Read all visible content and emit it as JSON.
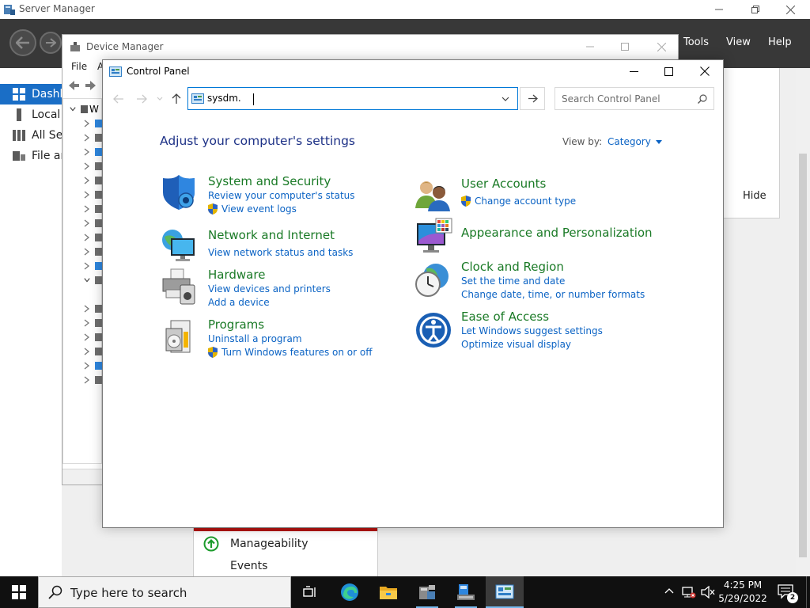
{
  "server_manager": {
    "title": "Server Manager",
    "menu": [
      "Tools",
      "View",
      "Help"
    ],
    "sidebar": [
      {
        "label": "Dashboard",
        "icon": "dashboard-grid-icon",
        "active": true
      },
      {
        "label": "Local Server",
        "icon": "server-icon",
        "active": false
      },
      {
        "label": "All Servers",
        "icon": "servers-icon",
        "active": false
      },
      {
        "label": "File and Storage Services",
        "icon": "storage-icon",
        "active": false
      }
    ],
    "hide_label": "Hide",
    "card": {
      "items": [
        {
          "label": "Manageability",
          "icon": "status-up-icon"
        },
        {
          "label": "Events",
          "icon": ""
        }
      ]
    }
  },
  "device_manager": {
    "title": "Device Manager",
    "menu": [
      "File",
      "A"
    ],
    "tree_root_label": "W"
  },
  "control_panel": {
    "title": "Control Panel",
    "address": "sysdm.",
    "search_placeholder": "Search Control Panel",
    "heading": "Adjust your computer's settings",
    "view_by_label": "View by:",
    "view_by_value": "Category",
    "categories": [
      {
        "title": "System and Security",
        "icon": "system-security-icon",
        "links": [
          {
            "label": "Review your computer's status",
            "shield": false
          },
          {
            "label": "View event logs",
            "shield": true
          }
        ]
      },
      {
        "title": "Network and Internet",
        "icon": "network-globe-icon",
        "links": [
          {
            "label": "View network status and tasks",
            "shield": false
          }
        ]
      },
      {
        "title": "Hardware",
        "icon": "printer-icon",
        "links": [
          {
            "label": "View devices and printers",
            "shield": false
          },
          {
            "label": "Add a device",
            "shield": false
          }
        ]
      },
      {
        "title": "Programs",
        "icon": "programs-disk-icon",
        "links": [
          {
            "label": "Uninstall a program",
            "shield": false
          },
          {
            "label": "Turn Windows features on or off",
            "shield": true
          }
        ]
      },
      {
        "title": "User Accounts",
        "icon": "user-accounts-icon",
        "links": [
          {
            "label": "Change account type",
            "shield": true
          }
        ]
      },
      {
        "title": "Appearance and Personalization",
        "icon": "appearance-monitor-icon",
        "links": []
      },
      {
        "title": "Clock and Region",
        "icon": "clock-globe-icon",
        "links": [
          {
            "label": "Set the time and date",
            "shield": false
          },
          {
            "label": "Change date, time, or number formats",
            "shield": false
          }
        ]
      },
      {
        "title": "Ease of Access",
        "icon": "ease-of-access-icon",
        "links": [
          {
            "label": "Let Windows suggest settings",
            "shield": false
          },
          {
            "label": "Optimize visual display",
            "shield": false
          }
        ]
      }
    ]
  },
  "taskbar": {
    "search_placeholder": "Type here to search",
    "apps": [
      "task-view-icon",
      "edge-icon",
      "file-explorer-icon",
      "server-manager-icon",
      "device-manager-icon",
      "control-panel-icon"
    ],
    "time": "4:25 PM",
    "date": "5/29/2022",
    "notification_count": "2"
  },
  "colors": {
    "heading": "#1e3287",
    "category_title": "#1a7a26",
    "link": "#0b63c4",
    "sm_nav": "#383838",
    "sm_active": "#1a6ec6"
  }
}
